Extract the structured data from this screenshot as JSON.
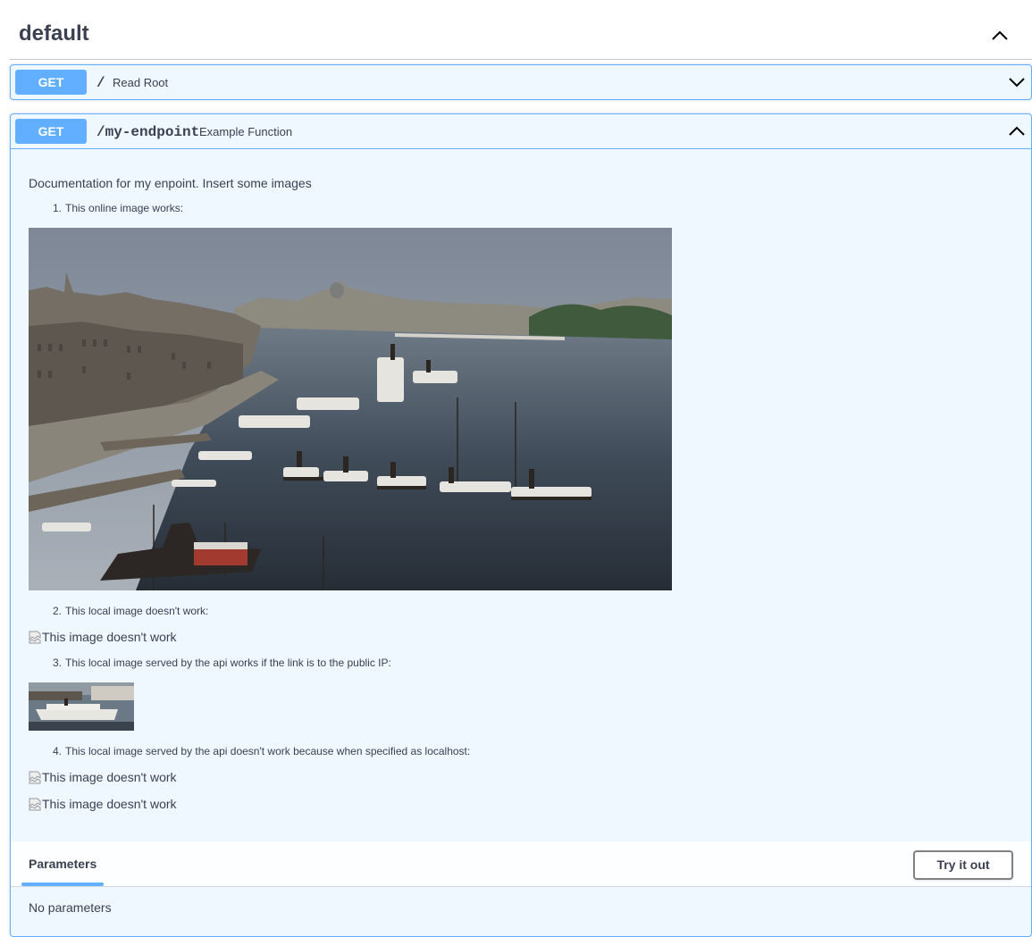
{
  "tag": {
    "title": "default"
  },
  "operations": [
    {
      "method": "GET",
      "path": "/",
      "summary": "Read Root"
    },
    {
      "method": "GET",
      "path": "/my-endpoint",
      "summary": "Example Function"
    }
  ],
  "doc": {
    "intro": "Documentation for my enpoint. Insert some images",
    "items": [
      {
        "num": "1.",
        "text": "This online image works:"
      },
      {
        "num": "2.",
        "text": "This local image doesn't work:"
      },
      {
        "num": "3.",
        "text": "This local image served by the api works if the link is to the public IP:"
      },
      {
        "num": "4.",
        "text": "This local image served by the api doesn't work because when specified as localhost:"
      }
    ],
    "broken_alt": "This image doesn't work"
  },
  "parameters": {
    "tab_label": "Parameters",
    "try_button": "Try it out",
    "empty_text": "No parameters"
  },
  "colors": {
    "get_accent": "#61affe",
    "text": "#3b4151"
  }
}
